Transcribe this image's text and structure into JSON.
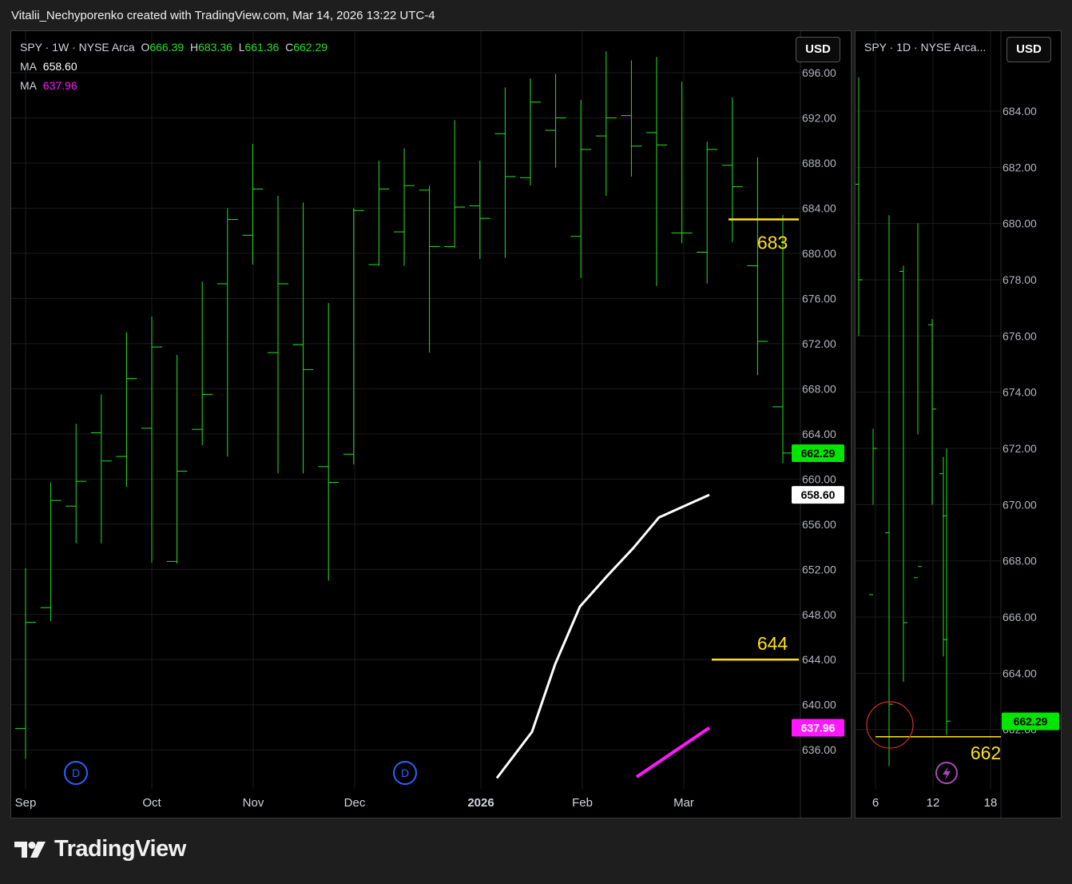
{
  "header": {
    "text": "Vitalii_Nechyporenko created with TradingView.com, Mar 14, 2026 13:22 UTC-4"
  },
  "brand": {
    "name": "TradingView",
    "icon": "tradingview-logo-icon"
  },
  "colors": {
    "bar": "#26e026",
    "ma_fast": "#ffffff",
    "ma_slow": "#ff18ff",
    "level": "#ffe119",
    "price_tag": "#00e600",
    "grid": "#1c1c1c"
  },
  "left": {
    "legend": {
      "symbol": "SPY · 1W · NYSE Arca",
      "o_label": "O",
      "o": "666.39",
      "h_label": "H",
      "h": "683.36",
      "l_label": "L",
      "l": "661.36",
      "c_label": "C",
      "c": "662.29",
      "ma1_label": "MA",
      "ma1": "658.60",
      "ma2_label": "MA",
      "ma2": "637.96"
    },
    "currency": "USD",
    "price_tag": "662.29",
    "ma1_tag": "658.60",
    "ma2_tag": "637.96",
    "level_high": "683",
    "level_low": "644",
    "dividend_marker": "D"
  },
  "right": {
    "legend": {
      "symbol": "SPY · 1D · NYSE Arca..."
    },
    "currency": "USD",
    "price_tag": "662.29",
    "level_label": "662",
    "event_icon": "lightning-icon"
  },
  "chart_data": [
    {
      "type": "ohlc",
      "title": "SPY · 1W · NYSE Arca",
      "y_ticks": [
        "696.00",
        "692.00",
        "688.00",
        "684.00",
        "680.00",
        "676.00",
        "672.00",
        "668.00",
        "664.00",
        "660.00",
        "656.00",
        "652.00",
        "648.00",
        "644.00",
        "640.00",
        "636.00"
      ],
      "x_ticks": [
        "Sep",
        "Oct",
        "Nov",
        "Dec",
        "2026",
        "Feb",
        "Mar"
      ],
      "ylim": [
        632.5,
        699.5
      ],
      "bars": [
        [
          637.9,
          652.1,
          635.2,
          647.3
        ],
        [
          648.6,
          659.7,
          647.4,
          658.1
        ],
        [
          657.6,
          664.9,
          654.3,
          659.8
        ],
        [
          664.1,
          667.5,
          654.3,
          661.6
        ],
        [
          662.0,
          673.0,
          659.3,
          668.9
        ],
        [
          664.5,
          674.4,
          652.6,
          671.7
        ],
        [
          652.7,
          671.0,
          652.5,
          660.7
        ],
        [
          664.4,
          677.5,
          663.0,
          667.5
        ],
        [
          677.3,
          684.0,
          662.0,
          683.0
        ],
        [
          681.6,
          689.7,
          679.0,
          685.7
        ],
        [
          671.2,
          685.1,
          660.5,
          677.3
        ],
        [
          671.9,
          684.5,
          660.5,
          669.7
        ],
        [
          661.1,
          675.6,
          651.0,
          659.7
        ],
        [
          662.2,
          684.0,
          661.3,
          683.8
        ],
        [
          679.0,
          688.2,
          678.9,
          685.7
        ],
        [
          681.9,
          689.3,
          678.9,
          686.0
        ],
        [
          685.6,
          686.0,
          671.2,
          680.6
        ],
        [
          680.6,
          691.8,
          680.5,
          684.1
        ],
        [
          684.2,
          688.2,
          679.5,
          683.1
        ],
        [
          690.6,
          694.7,
          679.6,
          686.8
        ],
        [
          686.7,
          695.5,
          686.0,
          693.4
        ],
        [
          690.9,
          695.9,
          687.6,
          692.0
        ],
        [
          681.5,
          693.6,
          677.8,
          689.2
        ],
        [
          690.4,
          697.9,
          685.1,
          692.0
        ],
        [
          692.2,
          697.1,
          686.8,
          689.5
        ],
        [
          690.7,
          697.4,
          677.1,
          689.6
        ],
        [
          681.8,
          695.2,
          680.9,
          681.8
        ],
        [
          680.1,
          689.9,
          677.3,
          689.2
        ],
        [
          687.8,
          693.8,
          681.0,
          685.9
        ],
        [
          678.9,
          688.5,
          669.2,
          672.2
        ],
        [
          666.4,
          683.4,
          661.4,
          662.3
        ]
      ],
      "series": [
        {
          "name": "MA",
          "values": [
            633.5,
            637.6,
            643.6,
            648.7,
            651.4,
            653.9,
            656.6,
            658.6
          ]
        },
        {
          "name": "MA",
          "values": [
            633.6,
            637.96
          ]
        }
      ],
      "levels": [
        683,
        644
      ]
    },
    {
      "type": "ohlc",
      "title": "SPY · 1D · NYSE Arca...",
      "y_ticks": [
        "684.00",
        "682.00",
        "680.00",
        "678.00",
        "676.00",
        "674.00",
        "672.00",
        "670.00",
        "668.00",
        "666.00",
        "664.00",
        "662.00"
      ],
      "x_ticks": [
        "6",
        "12",
        "18"
      ],
      "ylim": [
        660.7,
        686.6
      ],
      "bars": [
        [
          681.4,
          685.2,
          676.0,
          678.0
        ],
        [
          666.8,
          672.7,
          670.0,
          672.0
        ],
        [
          669.0,
          680.3,
          660.7,
          662.9
        ],
        [
          678.3,
          678.5,
          663.7,
          665.8
        ],
        [
          667.4,
          680.0,
          672.5,
          667.8
        ],
        [
          676.4,
          676.6,
          670.0,
          673.4
        ],
        [
          671.1,
          671.7,
          664.6,
          665.2
        ],
        [
          669.6,
          672.0,
          661.8,
          662.3
        ]
      ],
      "levels": [
        662
      ]
    }
  ]
}
